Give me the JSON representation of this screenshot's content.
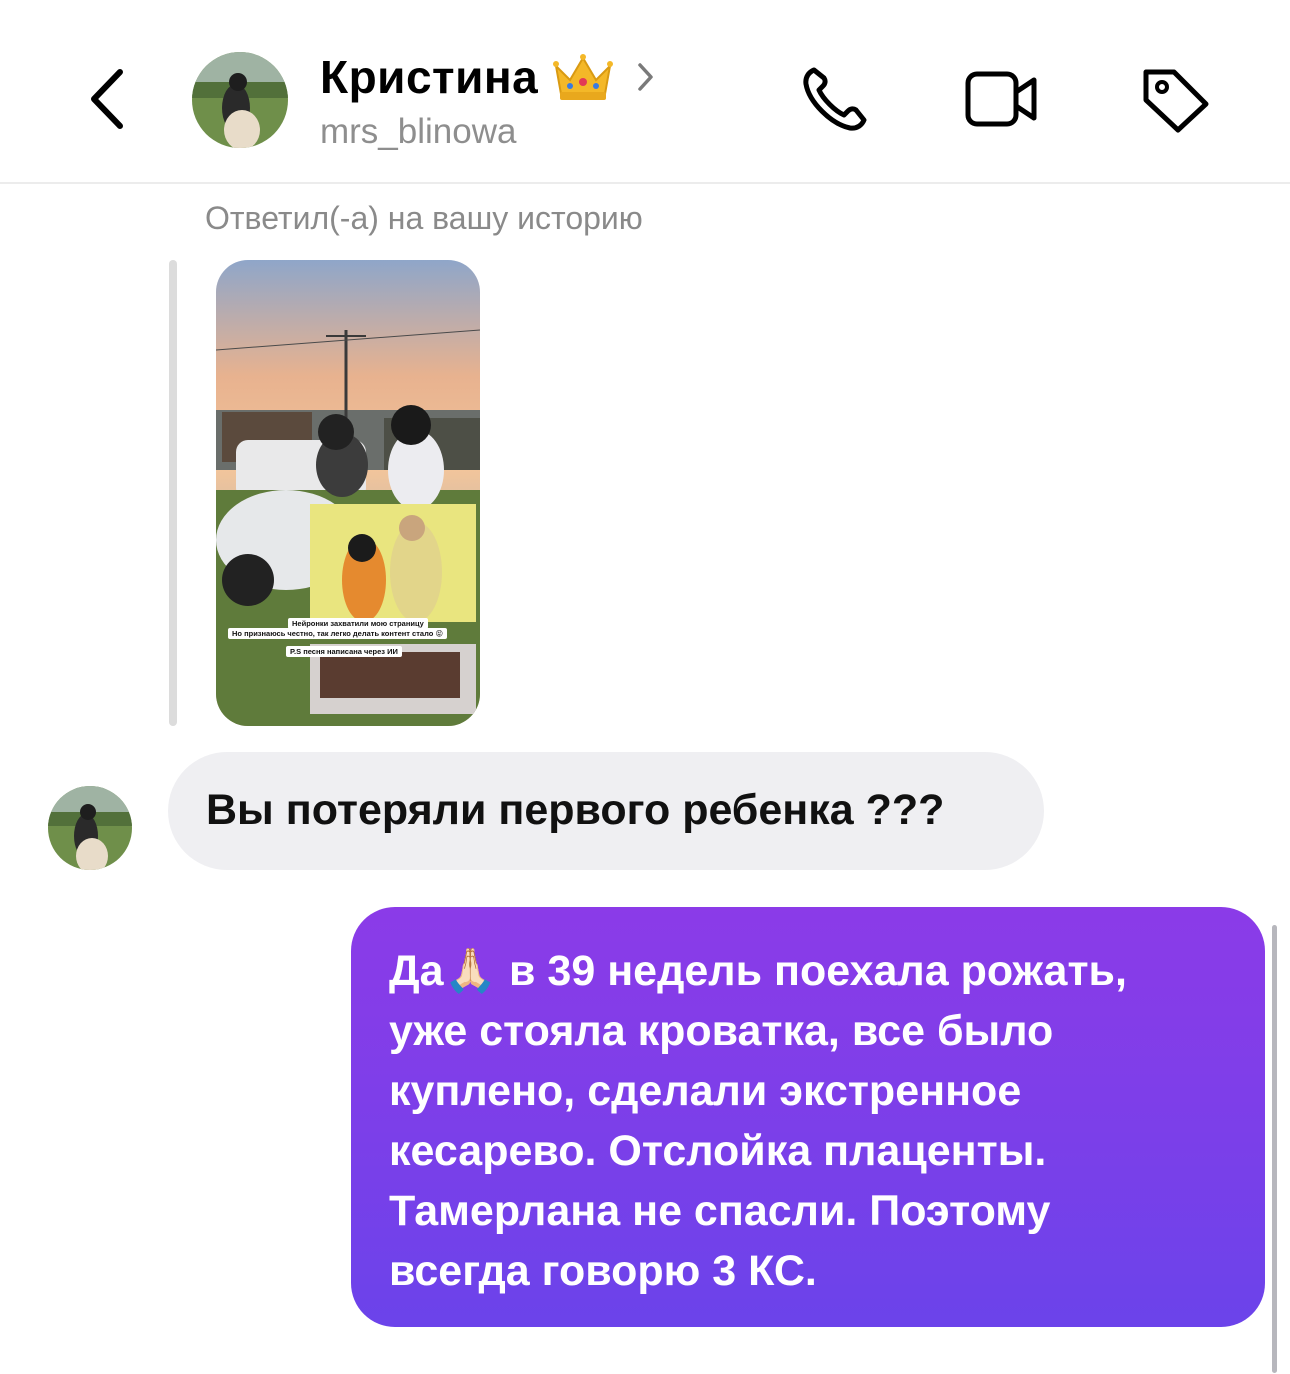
{
  "header": {
    "contact_name": "Кристина",
    "username": "mrs_blinowa",
    "icons": [
      "back-arrow-icon",
      "crown-emoji-icon",
      "chevron-right-icon",
      "phone-icon",
      "video-camera-icon",
      "tag-icon"
    ]
  },
  "thread": {
    "story_reply_label": "Ответил(-а) на вашу историю",
    "story_caption_line1": "Нейронки захватили мою страницу",
    "story_caption_line2": "Но признаюсь честно, так легко делать контент стало 😝",
    "story_caption_line3": "P.S песня написана через ИИ",
    "incoming_message": "Вы потеряли первого ребенка ???",
    "outgoing_message": "Да🙏🏻 в 39 недель поехала рожать,\nуже стояла кроватка, все было\nкуплено, сделали экстренное\nкесарево. Отслойка плаценты.\nТамерлана не спасли. Поэтому\nвсегда говорю 3 КС."
  },
  "colors": {
    "outgoing_bubble": "#7b3fe9",
    "incoming_bubble": "#efeff2",
    "secondary_text": "#8e8e8e"
  }
}
